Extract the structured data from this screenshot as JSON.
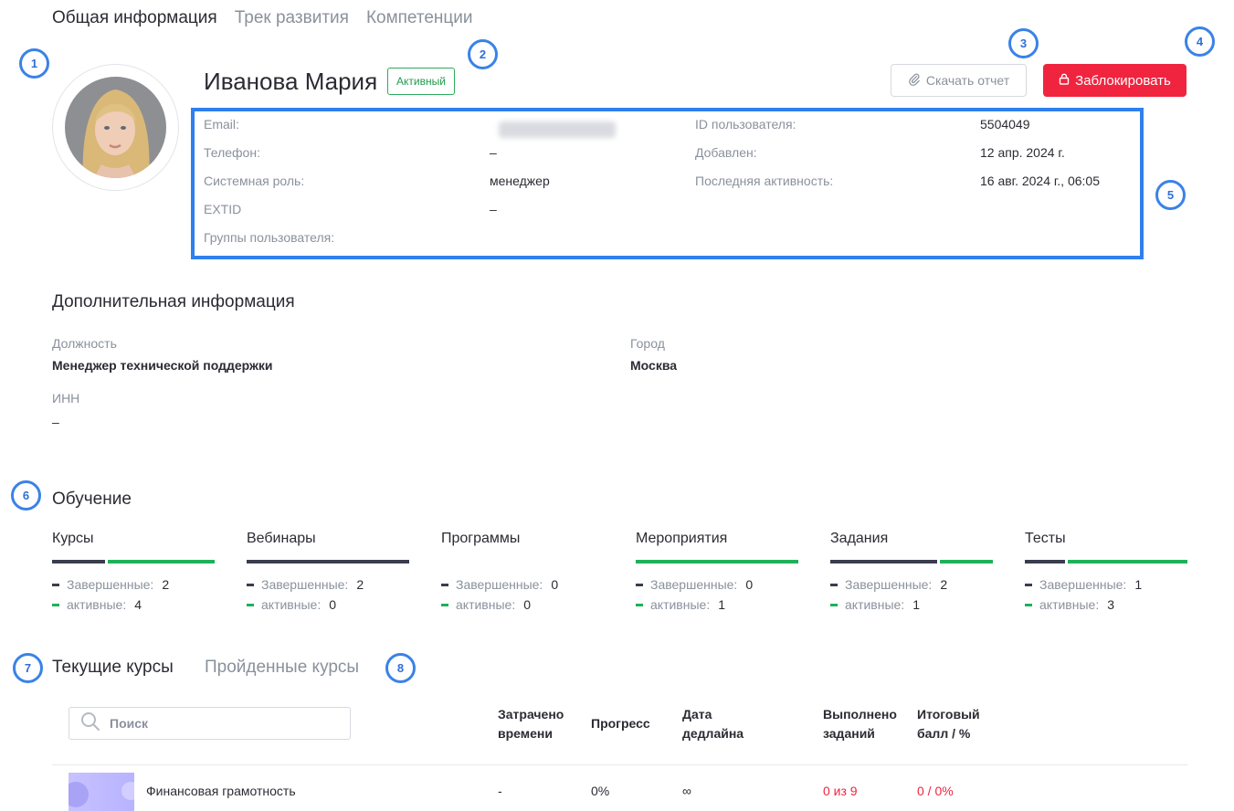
{
  "tabs": [
    "Общая информация",
    "Трек развития",
    "Компетенции"
  ],
  "callouts": [
    "1",
    "2",
    "3",
    "4",
    "5",
    "6",
    "7",
    "8"
  ],
  "user": {
    "name": "Иванова Мария",
    "status": "Активный"
  },
  "actions": {
    "download_label": "Скачать отчет",
    "block_label": "Заблокировать"
  },
  "info": {
    "email_label": "Email:",
    "phone_label": "Телефон:",
    "phone_value": "–",
    "role_label": "Системная роль:",
    "role_value": "менеджер",
    "extid_label": "EXTID",
    "extid_value": "–",
    "groups_label": "Группы пользователя:",
    "id_label": "ID пользователя:",
    "id_value": "5504049",
    "added_label": "Добавлен:",
    "added_value": "12 апр. 2024 г.",
    "last_active_label": "Последняя активность:",
    "last_active_value": "16 авг. 2024 г., 06:05"
  },
  "additional": {
    "title": "Дополнительная информация",
    "position_label": "Должность",
    "position_value": "Менеджер технической поддержки",
    "city_label": "Город",
    "city_value": "Москва",
    "inn_label": "ИНН",
    "inn_value": "–"
  },
  "learning": {
    "title": "Обучение",
    "completed_label": "Завершенные:",
    "active_label": "активные:",
    "colors": {
      "completed": "#3a3d4f",
      "active": "#1fb05a"
    },
    "stats": [
      {
        "title": "Курсы",
        "completed": "2",
        "active": "4"
      },
      {
        "title": "Вебинары",
        "completed": "2",
        "active": "0"
      },
      {
        "title": "Программы",
        "completed": "0",
        "active": "0"
      },
      {
        "title": "Мероприятия",
        "completed": "0",
        "active": "1"
      },
      {
        "title": "Задания",
        "completed": "2",
        "active": "1"
      },
      {
        "title": "Тесты",
        "completed": "1",
        "active": "3"
      }
    ]
  },
  "courses": {
    "current_tab": "Текущие курсы",
    "completed_tab": "Пройденные курсы",
    "search_placeholder": "Поиск",
    "headers": {
      "time_1": "Затрачено",
      "time_2": "времени",
      "progress": "Прогресс",
      "deadline_1": "Дата",
      "deadline_2": "дедлайна",
      "tasks_1": "Выполнено",
      "tasks_2": "заданий",
      "score_1": "Итоговый",
      "score_2": "балл / %"
    },
    "rows": [
      {
        "name": "Финансовая грамотность",
        "time": "-",
        "progress": "0%",
        "deadline": "∞",
        "tasks": "0 из 9",
        "score": "0 / 0%"
      }
    ]
  }
}
